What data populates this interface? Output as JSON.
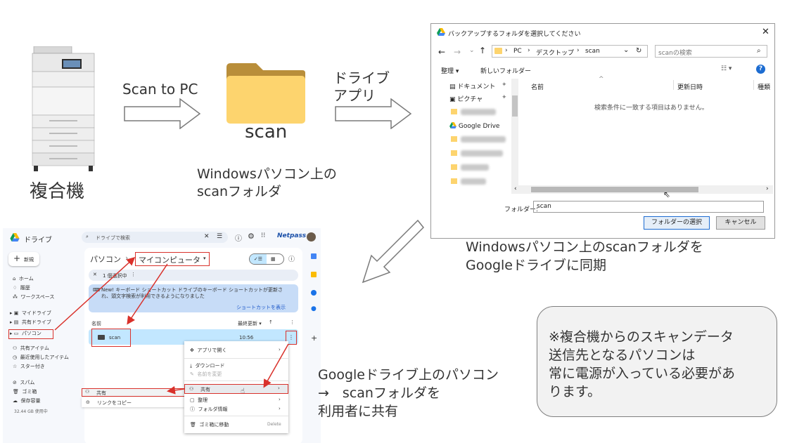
{
  "step1": {
    "device_label": "複合機",
    "arrow_label": "Scan to PC"
  },
  "step2": {
    "folder_name": "scan",
    "caption_lines": [
      "Windowsパソコン上の",
      "scanフォルダ"
    ],
    "arrow_label_lines": [
      "ドライブ",
      "アプリ"
    ]
  },
  "dialog": {
    "title": "バックアップするフォルダを選択してください",
    "breadcrumb": [
      "PC",
      "デスクトップ",
      "scan"
    ],
    "search_placeholder": "scanの検索",
    "organize": "整理",
    "new_folder": "新しいフォルダー",
    "nav_items": [
      "ドキュメント",
      "ピクチャ",
      "Google Drive"
    ],
    "columns": [
      "名前",
      "更新日時",
      "種類"
    ],
    "empty_message": "検索条件に一致する項目はありません。",
    "folder_label": "フォルダー:",
    "folder_value": "scan",
    "select_button": "フォルダーの選択",
    "cancel_button": "キャンセル"
  },
  "sync_caption_lines": [
    "Windowsパソコン上のscanフォルダを",
    "Googleドライブに同期"
  ],
  "drive": {
    "app_name": "ドライブ",
    "search_placeholder": "ドライブで検索",
    "brand": "Netpass",
    "new_button": "新規",
    "nav": [
      "ホーム",
      "履歴",
      "ワークスペース",
      "マイドライブ",
      "共有ドライブ",
      "パソコン",
      "共有アイテム",
      "最近使用したアイテム",
      "スター付き",
      "スパム",
      "ゴミ箱",
      "保存容量"
    ],
    "storage": "32.44 GB 使用中",
    "breadcrumb": [
      "パソコン",
      "マイコンピュータ"
    ],
    "selection": "1 個選択中",
    "banner": "New! キーボード ショートカット ドライブのキーボード ショートカットが更新され、頭文字検索が利用できるようになりました",
    "banner_link": "ショートカットを表示",
    "col_name": "名前",
    "col_modified": "最終更新",
    "row_name": "scan",
    "row_date": "10:56",
    "menu": [
      "アプリで開く",
      "ダウンロード",
      "名前を変更",
      "共有",
      "整理",
      "フォルダ情報",
      "ゴミ箱に移動"
    ],
    "menu_shortcut": "Delete",
    "submenu": [
      "共有",
      "リンクをコピー"
    ]
  },
  "share_caption_lines": [
    "Googleドライブ上のパソコン",
    "→　scanフォルダを",
    "利用者に共有"
  ],
  "note_lines": [
    "※複合機からのスキャンデータ",
    "送信先となるパソコンは",
    "常に電源が入っている必要があ",
    "ります。"
  ],
  "colors": {
    "highlight_red": "#d9312b",
    "folder_yellow": "#fdd46e",
    "drive_blue": "#1a73e8",
    "selected_row": "#c2e7ff"
  }
}
